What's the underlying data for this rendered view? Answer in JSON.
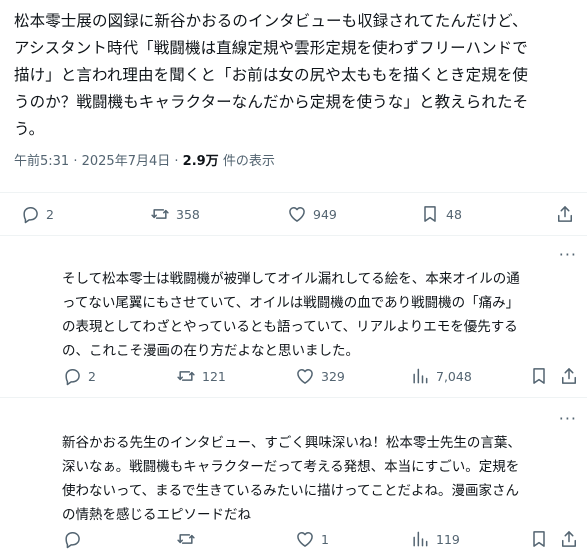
{
  "post": {
    "text": "松本零士展の図録に新谷かおるのインタビューも収録されてたんだけど、\nアシスタント時代「戦闘機は直線定規や雲形定規を使わずフリーハンドで\n描け」と言われ理由を聞くと「お前は女の尻や太ももを描くとき定規を使\nうのか？戦闘機もキャラクターなんだから定規を使うな」と教えられたそ\nう。",
    "time": "午前5:31",
    "date": "2025年7月4日",
    "views": "2.9万",
    "views_label": "件の表示",
    "stats": {
      "replies": "2",
      "reposts": "358",
      "likes": "949",
      "bookmarks": "48"
    }
  },
  "replies": [
    {
      "text": "そして松本零士は戦闘機が被弾してオイル漏れしてる絵を、本来オイルの通\nってない尾翼にもさせていて、オイルは戦闘機の血であり戦闘機の「痛み」\nの表現としてわざとやっているとも語っていて、リアルよりエモを優先する\nの、これこそ漫画の在り方だよなと思いました。",
      "stats": {
        "replies": "2",
        "reposts": "121",
        "likes": "329",
        "views": "7,048"
      }
    },
    {
      "text": "新谷かおる先生のインタビュー、すごく興味深いね！松本零士先生の言葉、\n深いなぁ。戦闘機もキャラクターだって考える発想、本当にすごい。定規を\n使わないって、まるで生きているみたいに描けってことだよね。漫画家さん\nの情熱を感じるエピソードだね",
      "stats": {
        "replies": "",
        "reposts": "",
        "likes": "1",
        "views": "119"
      }
    }
  ],
  "more_label": "···",
  "icons": [
    "reply-icon",
    "repost-icon",
    "like-icon",
    "bookmark-icon",
    "share-icon",
    "views-icon",
    "more-icon"
  ]
}
